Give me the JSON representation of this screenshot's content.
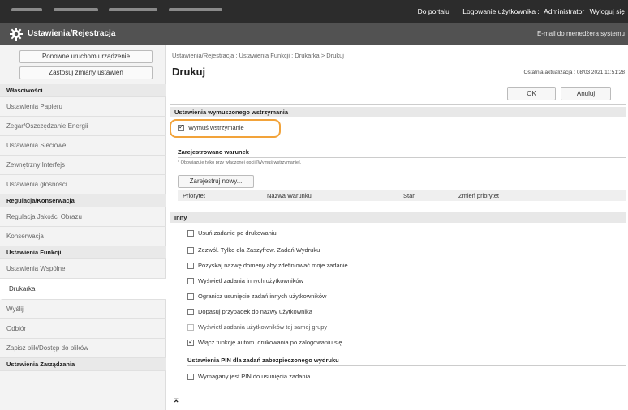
{
  "topbar": {
    "portal_link": "Do portalu",
    "login_label": "Logowanie użytkownika :",
    "user": "Administrator",
    "logout": "Wyloguj się"
  },
  "titlebar": {
    "title": "Ustawienia/Rejestracja",
    "mail_admin": "E-mail do menedżera systemu",
    "gear_icon": "gear-icon"
  },
  "sidebar": {
    "restart_button": "Ponowne uruchom urządzenie",
    "apply_button": "Zastosuj zmiany ustawień",
    "items": [
      {
        "label": "Właściwości",
        "type": "header"
      },
      {
        "label": "Ustawienia Papieru",
        "type": "link"
      },
      {
        "label": "Zegar/Oszczędzanie Energii",
        "type": "link"
      },
      {
        "label": "Ustawienia Sieciowe",
        "type": "link"
      },
      {
        "label": "Zewnętrzny Interfejs",
        "type": "link"
      },
      {
        "label": "Ustawienia głośności",
        "type": "link"
      },
      {
        "label": "Regulacja/Konserwacja",
        "type": "header"
      },
      {
        "label": "Regulacja Jakości Obrazu",
        "type": "link"
      },
      {
        "label": "Konserwacja",
        "type": "link"
      },
      {
        "label": "Ustawienia Funkcji",
        "type": "header"
      },
      {
        "label": "Ustawienia Wspólne",
        "type": "link"
      },
      {
        "label": "Drukarka",
        "type": "active"
      },
      {
        "label": "Wyślij",
        "type": "link"
      },
      {
        "label": "Odbiór",
        "type": "link"
      },
      {
        "label": "Zapisz plik/Dostęp do plików",
        "type": "link"
      },
      {
        "label": "Ustawienia Zarządzania",
        "type": "header"
      }
    ]
  },
  "main": {
    "breadcrumb": "Ustawienia/Rejestracja : Ustawienia Funkcji : Drukarka > Drukuj",
    "title": "Drukuj",
    "last_updated": "Ostatnia aktualizacja : 08/03 2021 11:51:28",
    "ok_button": "OK",
    "cancel_button": "Anuluj",
    "forced_hold": {
      "section_title": "Ustawienia wymuszonego wstrzymania",
      "checkbox_label": "Wymuś wstrzymanie",
      "checked": true,
      "registered_condition_title": "Zarejestrowano warunek",
      "note": "* Obowiązuje tylko przy włączonej opcji [Wymuś wstrzymanie].",
      "register_new_button": "Zarejestruj nowy...",
      "table_headers": [
        "Priorytet",
        "Nazwa Warunku",
        "Stan",
        "Zmień priorytet"
      ]
    },
    "other": {
      "section_title": "Inny",
      "options": [
        {
          "label": "Usuń zadanie po drukowaniu",
          "checked": false,
          "disabled": false
        },
        {
          "label": "Zezwól. Tylko dla Zaszyfrow. Zadań Wydruku",
          "checked": false,
          "disabled": false
        },
        {
          "label": "Pozyskaj nazwę domeny aby zdefiniować moje zadanie",
          "checked": false,
          "disabled": false
        },
        {
          "label": "Wyświetl zadania innych użytkowników",
          "checked": false,
          "disabled": false
        },
        {
          "label": "Ogranicz usunięcie zadań innych użytkowników",
          "checked": false,
          "disabled": false
        },
        {
          "label": "Dopasuj przypadek do nazwy użytkownika",
          "checked": false,
          "disabled": false
        },
        {
          "label": "Wyświetl zadania użytkowników tej samej grupy",
          "checked": false,
          "disabled": true
        },
        {
          "label": "Włącz funkcję autom. drukowania po zalogowaniu się",
          "checked": true,
          "disabled": false
        }
      ],
      "pin_section_title": "Ustawienia PIN dla zadań zabezpieczonego wydruku",
      "pin_option": {
        "label": "Wymagany jest PIN do usunięcia zadania",
        "checked": false
      }
    },
    "scroll_top_icon": "⌅"
  },
  "colors": {
    "highlight": "#f2a33a",
    "topbar": "#2c2c2c",
    "titlebar": "#525252"
  }
}
